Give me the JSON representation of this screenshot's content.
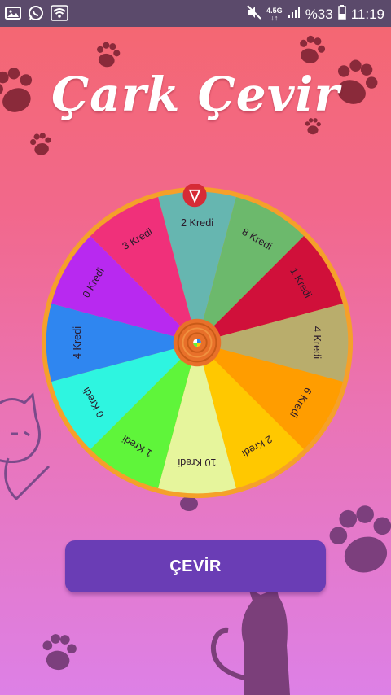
{
  "status_bar": {
    "network": "4.5G",
    "network_sub": "↓↑",
    "battery": "%33",
    "time": "11:19",
    "icons": [
      "gallery-icon",
      "whatsapp-icon",
      "wifi-icon",
      "mute-icon",
      "signal-icon",
      "battery-icon"
    ]
  },
  "header": {
    "title": "Çark Çevir"
  },
  "wheel": {
    "segments": [
      {
        "label": "2 Kredi",
        "color": "#66b6b0"
      },
      {
        "label": "8 Kredi",
        "color": "#6cb96c"
      },
      {
        "label": "1 Kredi",
        "color": "#d0103a"
      },
      {
        "label": "4 Kredi",
        "color": "#b9ad6c"
      },
      {
        "label": "6 Kredi",
        "color": "#ff9d00"
      },
      {
        "label": "2 Kredi",
        "color": "#ffc800"
      },
      {
        "label": "10 Kredi",
        "color": "#e6f59c"
      },
      {
        "label": "1 Kredi",
        "color": "#5ff53a"
      },
      {
        "label": "0 Kredi",
        "color": "#2ef5e0"
      },
      {
        "label": "4 Kredi",
        "color": "#2f86f0"
      },
      {
        "label": "0 Kredi",
        "color": "#b829f0"
      },
      {
        "label": "3 Kredi",
        "color": "#f0307a"
      }
    ],
    "rim_color": "#f5a02a",
    "pointer_icon": "pointer-icon",
    "hub_icon": "wheel-hub-icon"
  },
  "action": {
    "spin_label": "ÇEVİR"
  },
  "colors": {
    "accent": "#6a3db5",
    "status_bar": "#5b4a6b"
  }
}
